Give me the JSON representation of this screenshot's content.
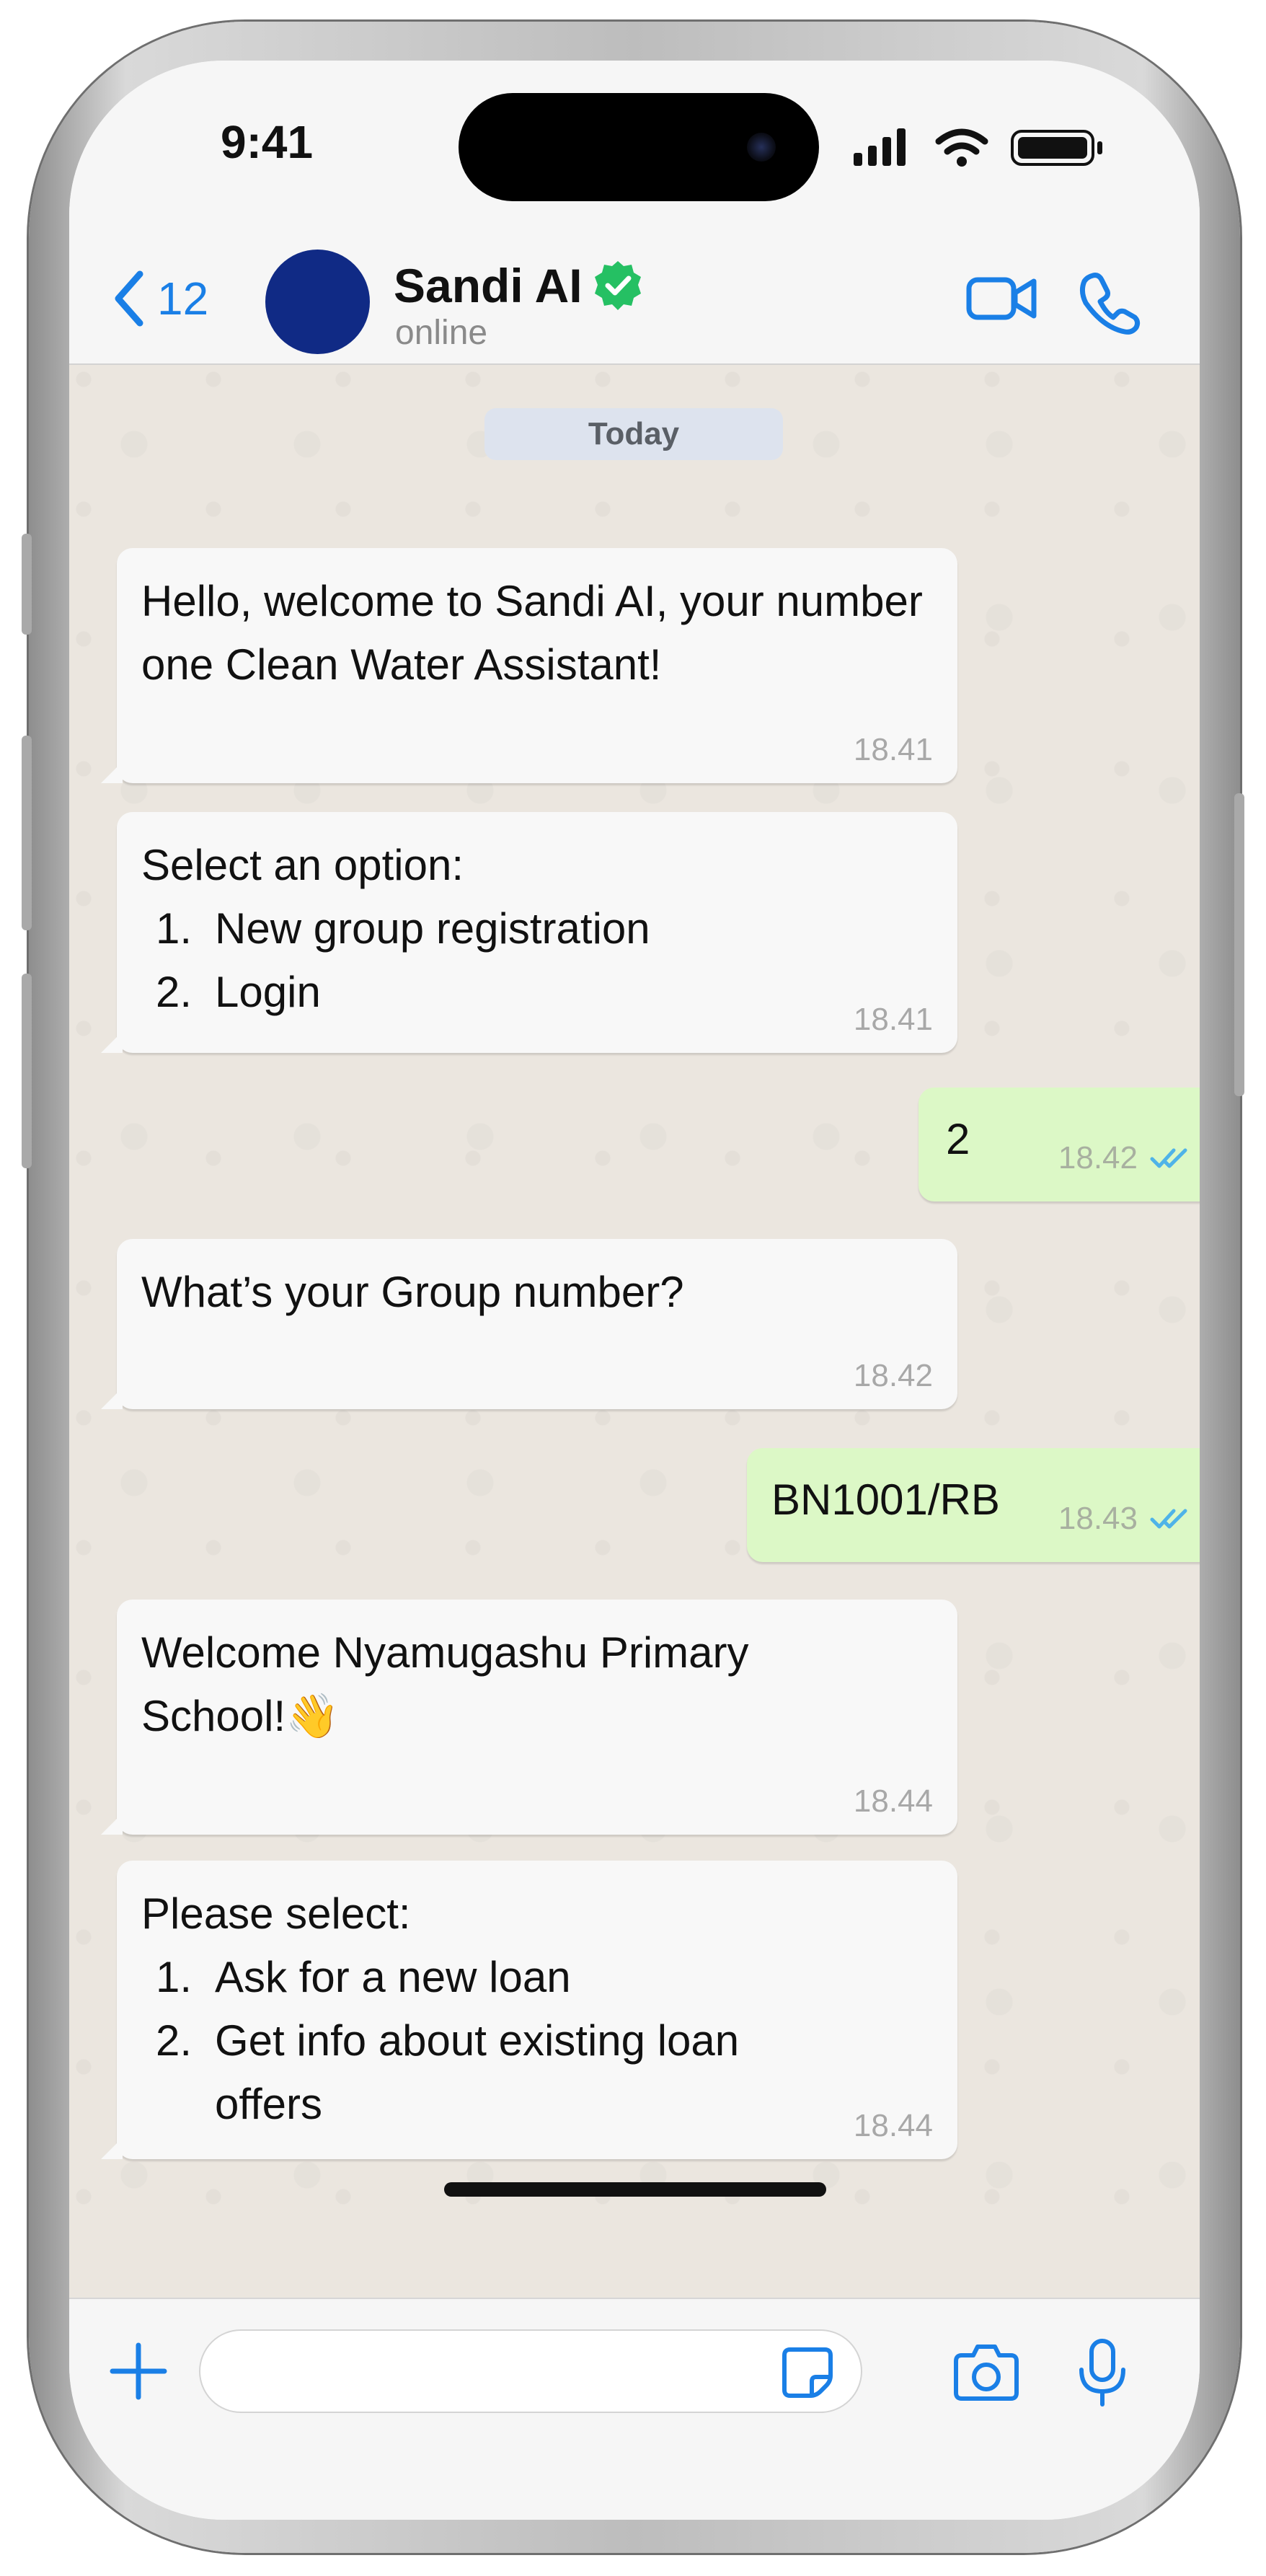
{
  "status_bar": {
    "time": "9:41"
  },
  "header": {
    "back_count": "12",
    "contact_name": "Sandi AI",
    "contact_status": "online"
  },
  "chat": {
    "date_chip": "Today",
    "messages": [
      {
        "direction": "incoming",
        "text": "Hello, welcome to Sandi AI, your number one Clean Water Assistant!",
        "time": "18.41"
      },
      {
        "direction": "incoming",
        "intro": "Select an option:",
        "options": [
          "New group registration",
          "Login"
        ],
        "time": "18.41"
      },
      {
        "direction": "outgoing",
        "text": "2",
        "time": "18.42",
        "status": "read"
      },
      {
        "direction": "incoming",
        "text": "What’s your Group number?",
        "time": "18.42"
      },
      {
        "direction": "outgoing",
        "text": "BN1001/RB",
        "time": "18.43",
        "status": "read"
      },
      {
        "direction": "incoming",
        "text": "Welcome Nyamugashu Primary School!👋",
        "time": "18.44"
      },
      {
        "direction": "incoming",
        "intro": "Please select:",
        "options": [
          "Ask for a new loan",
          "Get info about existing loan offers"
        ],
        "time": "18.44"
      }
    ]
  },
  "composer": {
    "value": "",
    "placeholder": ""
  },
  "colors": {
    "accent": "#1a7fe6",
    "verified": "#25c063",
    "incoming_bubble": "#f8f8f8",
    "outgoing_bubble": "#dcf8c6",
    "read_ticks": "#4fb3e8",
    "avatar": "#102a85"
  },
  "icons": {
    "back": "chevron-left-icon",
    "verified": "verified-badge-icon",
    "video_call": "video-camera-icon",
    "voice_call": "phone-icon",
    "attach": "plus-icon",
    "sticker": "sticker-icon",
    "camera": "camera-icon",
    "microphone": "microphone-icon"
  }
}
